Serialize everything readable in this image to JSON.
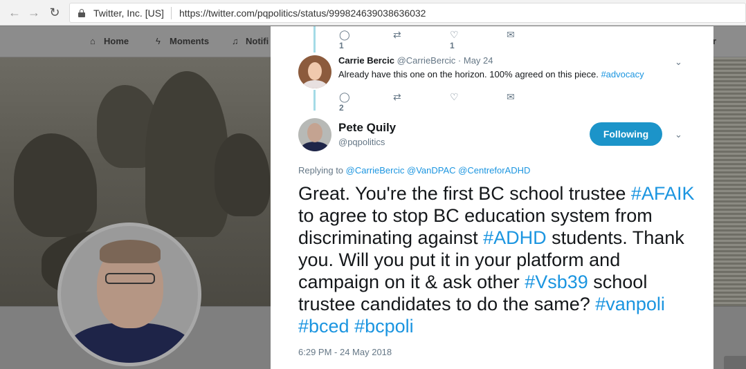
{
  "browser": {
    "site_identity": "Twitter, Inc. [US]",
    "url": "https://twitter.com/pqpolitics/status/999824639038636032"
  },
  "twitter_nav": {
    "home": "Home",
    "moments": "Moments",
    "notifications": "Notifi",
    "right": "r"
  },
  "thread": {
    "prev_actions": {
      "replies": "1",
      "likes": "1"
    },
    "reply": {
      "name": "Carrie Bercic",
      "handle": "@CarrieBercic",
      "date": "· May 24",
      "text": "Already have this one on the horizon.  100% agreed on this piece.",
      "hashtag": "#advocacy",
      "replies": "2"
    },
    "main": {
      "name": "Pete Quily",
      "handle": "@pqpolitics",
      "follow_label": "Following",
      "replying_prefix": "Replying to",
      "replying_to": [
        "@CarrieBercic",
        "@VanDPAC",
        "@CentreforADHD"
      ],
      "text_parts": [
        {
          "t": "Great. You're the first BC school trustee ",
          "link": false
        },
        {
          "t": "#AFAIK",
          "link": true
        },
        {
          "t": " to agree to stop BC education system from discriminating against ",
          "link": false
        },
        {
          "t": "#ADHD",
          "link": true
        },
        {
          "t": " students. Thank you. Will you put it in your platform and campaign on it & ask other ",
          "link": false
        },
        {
          "t": "#Vsb39",
          "link": true
        },
        {
          "t": " school trustee candidates to do the same? ",
          "link": false
        },
        {
          "t": "#vanpoli",
          "link": true
        },
        {
          "t": " ",
          "link": false
        },
        {
          "t": "#bced",
          "link": true
        },
        {
          "t": " ",
          "link": false
        },
        {
          "t": "#bcpoli",
          "link": true
        }
      ],
      "timestamp": "6:29 PM - 24 May 2018"
    }
  },
  "colors": {
    "link": "#1b95e0",
    "follow_button": "#1c94c9",
    "thread_line": "#a4dbe6"
  }
}
